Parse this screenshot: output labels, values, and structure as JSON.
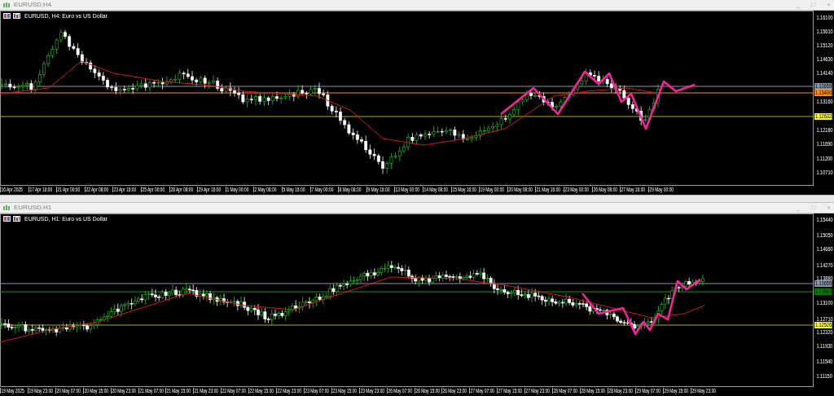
{
  "charts": [
    {
      "window_title": "EURUSD,H4",
      "header": "EURUSD, H4: Euro vs US Dollar",
      "window_buttons": [
        "_",
        "□",
        "×"
      ],
      "price_ticks": [
        "1.16100",
        "1.15610",
        "1.15120",
        "1.14630",
        "1.14140",
        "1.13160",
        "1.12180",
        "1.11690",
        "1.11200",
        "1.10710"
      ],
      "price_badges": [
        {
          "text": "1.13655",
          "color": "#8796a8"
        },
        {
          "text": "1.13400",
          "color": "#ff8c00"
        },
        {
          "text": "1.12632",
          "color": "#ffff00"
        }
      ],
      "time_ticks": [
        "16 Apr 2025",
        "17 Apr 16:00",
        "21 Apr 00:00",
        "22 Apr 08:00",
        "23 Apr 16:00",
        "25 Apr 00:00",
        "28 Apr 08:00",
        "29 Apr 16:00",
        "1 May 00:00",
        "2 May 08:00",
        "5 May 16:00",
        "7 May 00:00",
        "8 May 08:00",
        "9 May 16:00",
        "13 May 00:00",
        "14 May 08:00",
        "15 May 16:00",
        "19 May 00:00",
        "20 May 08:00",
        "21 May 16:00",
        "23 May 00:00",
        "26 May 08:00",
        "27 May 16:00",
        "29 May 00:00"
      ]
    },
    {
      "window_title": "EURUSD,H1",
      "header": "EURUSD, H1: Euro vs US Dollar",
      "window_buttons": [
        "_",
        "□",
        "×"
      ],
      "price_ticks": [
        "1.15440",
        "1.15050",
        "1.14660",
        "1.14270",
        "1.13880",
        "1.13100",
        "1.12710",
        "1.12320",
        "1.11930",
        "1.11540",
        "1.11150"
      ],
      "price_badges": [
        {
          "text": "1.13655",
          "color": "#8796a8"
        },
        {
          "text": "1.13582",
          "color": "#008000"
        },
        {
          "text": "1.12526",
          "color": "#ffff00"
        }
      ],
      "time_ticks": [
        "19 May 2025",
        "19 May 23:00",
        "20 May 07:00",
        "20 May 15:00",
        "20 May 23:00",
        "21 May 07:00",
        "21 May 15:00",
        "21 May 23:00",
        "22 May 07:00",
        "22 May 15:00",
        "22 May 23:00",
        "23 May 07:00",
        "23 May 15:00",
        "23 May 23:00",
        "26 May 07:00",
        "26 May 15:00",
        "26 May 23:00",
        "27 May 07:00",
        "27 May 15:00",
        "27 May 23:00",
        "28 May 07:00",
        "28 May 15:00",
        "28 May 23:00",
        "29 May 07:00",
        "29 May 15:00",
        "29 May 23:00"
      ]
    }
  ]
}
